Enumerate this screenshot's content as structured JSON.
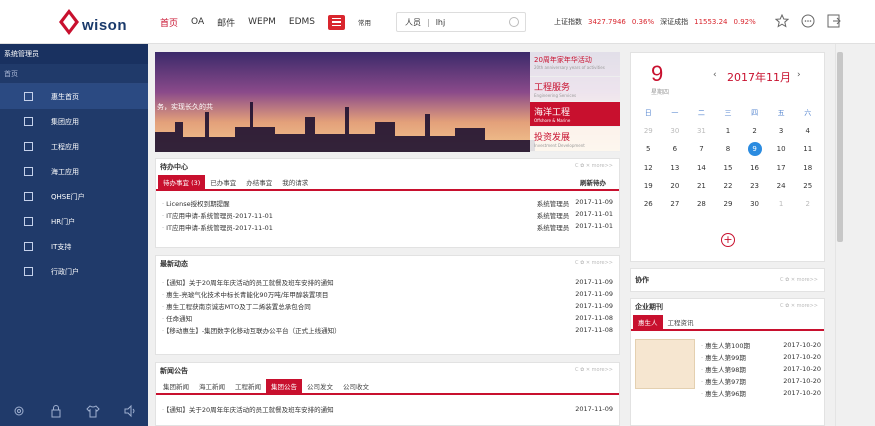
{
  "header": {
    "logo_text": "wison",
    "nav": [
      "首页",
      "OA",
      "邮件",
      "WEPM",
      "EDMS"
    ],
    "menu_label": "常用",
    "search": {
      "category": "人员",
      "value": "lhj"
    },
    "ticker": [
      {
        "label": "上证指数",
        "value": "3427.7946"
      },
      {
        "label": "",
        "value": "0.36%"
      },
      {
        "label": "深证成指",
        "value": "11553.24"
      },
      {
        "label": "",
        "value": "0.92%"
      }
    ],
    "icons": [
      "star-icon",
      "chat-icon",
      "logout-icon"
    ]
  },
  "sidebar": {
    "admin_label": "系统管理员",
    "home_label": "首页",
    "items": [
      {
        "label": "惠生首页",
        "icon": "home-icon"
      },
      {
        "label": "集团应用",
        "icon": "app-icon"
      },
      {
        "label": "工程应用",
        "icon": "tools-icon"
      },
      {
        "label": "海工应用",
        "icon": "doc-icon"
      },
      {
        "label": "QHSE门户",
        "icon": "shield-icon"
      },
      {
        "label": "HR门户",
        "icon": "people-icon"
      },
      {
        "label": "IT支持",
        "icon": "monitor-icon"
      },
      {
        "label": "行政门户",
        "icon": "building-icon"
      }
    ],
    "bottom_icons": [
      "settings-icon",
      "lock-icon",
      "shirt-icon",
      "volume-icon"
    ]
  },
  "banner": {
    "slogan": "务，实现长久的共",
    "tabs": [
      {
        "title": "20周年家年华活动",
        "sub": "20th anniversary years of activities"
      },
      {
        "title": "工程服务",
        "sub": "Engineering Services"
      },
      {
        "title": "海洋工程",
        "sub": "Offshore & Marine"
      },
      {
        "title": "投资发展",
        "sub": "Investment Development"
      }
    ]
  },
  "todo": {
    "title": "待办中心",
    "tabs": [
      "待办事宜 (3)",
      "已办事宜",
      "办结事宜",
      "我的请求"
    ],
    "refresh": "刷新待办",
    "rows": [
      {
        "text": "License授权到期提醒",
        "who": "系统管理员",
        "date": "2017-11-09"
      },
      {
        "text": "IT应用申请-系统管理员-2017-11-01",
        "who": "系统管理员",
        "date": "2017-11-01"
      },
      {
        "text": "IT应用申请-系统管理员-2017-11-01",
        "who": "系统管理员",
        "date": "2017-11-01"
      }
    ]
  },
  "news": {
    "title": "最新动态",
    "rows": [
      {
        "text": "【通知】关于20周年年庆活动的员工就餐及班车安排的通知",
        "date": "2017-11-09"
      },
      {
        "text": "惠生-亮琥气化技术中标长青能化90万吨/年甲醇装置项目",
        "date": "2017-11-09"
      },
      {
        "text": "惠生工程获南京诚志MTO及丁二烯装置总承包合同",
        "date": "2017-11-09"
      },
      {
        "text": "任命通知",
        "date": "2017-11-08"
      },
      {
        "text": "【移动惠生】-集团数字化移动互联办公平台（正式上线通知）",
        "date": "2017-11-08"
      }
    ]
  },
  "notice": {
    "title": "新闻公告",
    "tabs": [
      "集团新闻",
      "海工新闻",
      "工程新闻",
      "集团公告",
      "公司发文",
      "公司收文"
    ],
    "rows": [
      {
        "text": "【通知】关于20周年年庆活动的员工就餐及班车安排的通知",
        "date": "2017-11-09"
      }
    ]
  },
  "calendar": {
    "day": "9",
    "weekday": "星期四",
    "month": "2017年11月",
    "headers": [
      "日",
      "一",
      "二",
      "三",
      "四",
      "五",
      "六"
    ],
    "weeks": [
      [
        "29",
        "30",
        "31",
        "1",
        "2",
        "3",
        "4"
      ],
      [
        "5",
        "6",
        "7",
        "8",
        "9",
        "10",
        "11"
      ],
      [
        "12",
        "13",
        "14",
        "15",
        "16",
        "17",
        "18"
      ],
      [
        "19",
        "20",
        "21",
        "22",
        "23",
        "24",
        "25"
      ],
      [
        "26",
        "27",
        "28",
        "29",
        "30",
        "1",
        "2"
      ]
    ]
  },
  "collab": {
    "title": "协作"
  },
  "journal": {
    "title": "企业期刊",
    "tabs": [
      "惠生人",
      "工程资讯"
    ],
    "rows": [
      {
        "text": "惠生人第100期",
        "date": "2017-10-20"
      },
      {
        "text": "惠生人第99期",
        "date": "2017-10-20"
      },
      {
        "text": "惠生人第98期",
        "date": "2017-10-20"
      },
      {
        "text": "惠生人第97期",
        "date": "2017-10-20"
      },
      {
        "text": "惠生人第96期",
        "date": "2017-10-20"
      }
    ]
  },
  "panel_ctl": "C ✿ ✕  more>>"
}
